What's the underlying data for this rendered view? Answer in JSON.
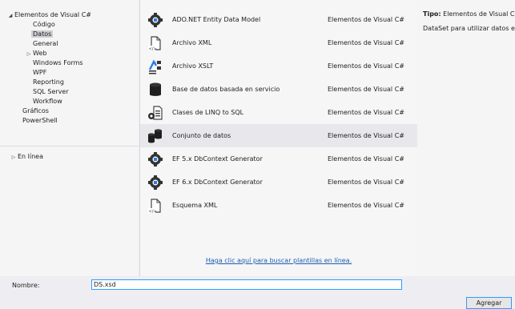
{
  "tree": {
    "root": "Elementos de Visual C#",
    "children": [
      "Código",
      "Datos",
      "General",
      "Web",
      "Windows Forms",
      "WPF",
      "Reporting",
      "SQL Server",
      "Workflow"
    ],
    "graficos": "Gráficos",
    "powershell": "PowerShell",
    "en_linea": "En línea"
  },
  "templates": [
    {
      "name": "ADO.NET Entity Data Model",
      "category": "Elementos de Visual C#",
      "icon": "entity-model-icon"
    },
    {
      "name": "Archivo XML",
      "category": "Elementos de Visual C#",
      "icon": "xml-file-icon"
    },
    {
      "name": "Archivo XSLT",
      "category": "Elementos de Visual C#",
      "icon": "xslt-file-icon"
    },
    {
      "name": "Base de datos basada en servicio",
      "category": "Elementos de Visual C#",
      "icon": "database-icon"
    },
    {
      "name": "Clases de LINQ to SQL",
      "category": "Elementos de Visual C#",
      "icon": "linq-classes-icon"
    },
    {
      "name": "Conjunto de datos",
      "category": "Elementos de Visual C#",
      "icon": "dataset-icon",
      "selected": true
    },
    {
      "name": "EF 5.x DbContext Generator",
      "category": "Elementos de Visual C#",
      "icon": "dbcontext-generator-icon"
    },
    {
      "name": "EF 6.x DbContext Generator",
      "category": "Elementos de Visual C#",
      "icon": "dbcontext-generator-icon"
    },
    {
      "name": "Esquema XML",
      "category": "Elementos de Visual C#",
      "icon": "xml-schema-icon"
    }
  ],
  "online_link": "Haga clic aquí para buscar plantillas en línea.",
  "info": {
    "type_label": "Tipo:",
    "type_value": "Elementos de Visual C",
    "description": "DataSet para utilizar datos en"
  },
  "bottom": {
    "name_label": "Nombre:",
    "name_value": "DS.xsd",
    "add_button": "Agregar"
  }
}
